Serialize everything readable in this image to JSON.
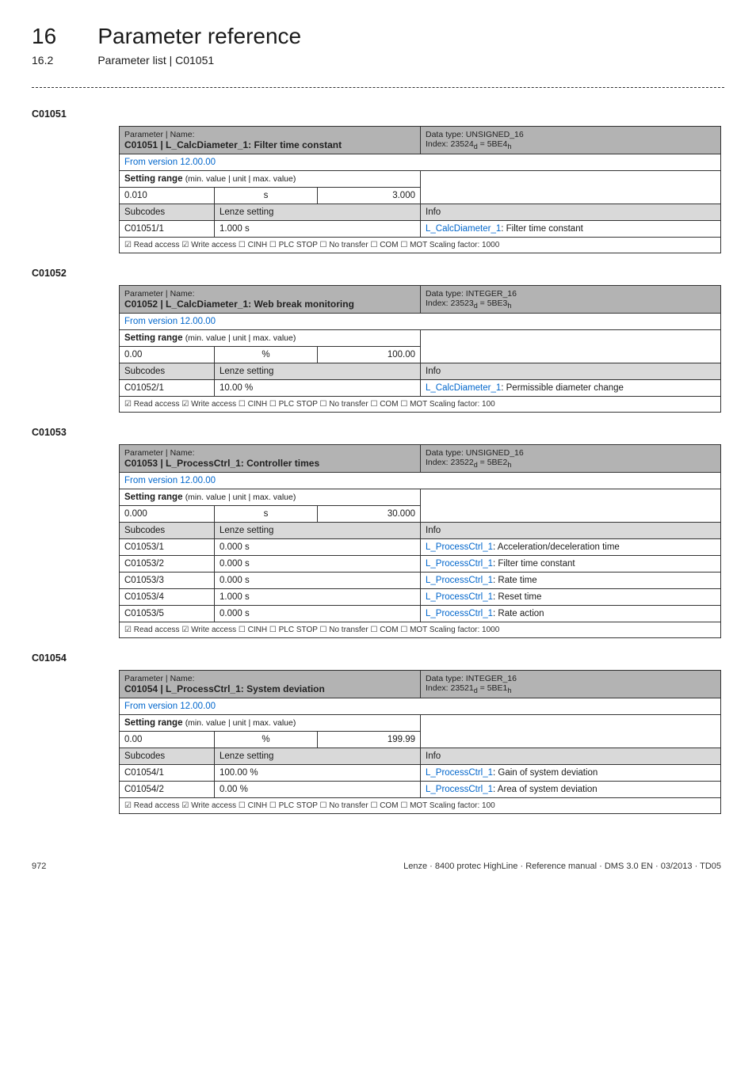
{
  "header": {
    "chapter_num": "16",
    "chapter_title": "Parameter reference",
    "sub_num": "16.2",
    "sub_title": "Parameter list | C01051"
  },
  "tables": {
    "t1": {
      "anchor": "C01051",
      "hdr_label": "Parameter | Name:",
      "name": "C01051 | L_CalcDiameter_1: Filter time constant",
      "dt_line1": "Data type: UNSIGNED_16",
      "dt_line2_prefix": "Index: 23524",
      "dt_line2_sub1": "d",
      "dt_line2_mid": " = 5BE4",
      "dt_line2_sub2": "h",
      "version": "From version 12.00.00",
      "range_label": "Setting range ",
      "range_sub": "(min. value | unit | max. value)",
      "min": "0.010",
      "unit": "s",
      "max": "3.000",
      "sub_hdr1": "Subcodes",
      "sub_hdr2": "Lenze setting",
      "sub_hdr3": "Info",
      "rows": [
        {
          "code": "C01051/1",
          "setting": "1.000 s",
          "info_link": "L_CalcDiameter_1",
          "info_rest": ": Filter time constant"
        }
      ],
      "footer": "☑ Read access   ☑ Write access   ☐ CINH   ☐ PLC STOP   ☐ No transfer   ☐ COM   ☐ MOT     Scaling factor: 1000"
    },
    "t2": {
      "anchor": "C01052",
      "hdr_label": "Parameter | Name:",
      "name": "C01052 | L_CalcDiameter_1: Web break monitoring",
      "dt_line1": "Data type: INTEGER_16",
      "dt_line2_prefix": "Index: 23523",
      "dt_line2_sub1": "d",
      "dt_line2_mid": " = 5BE3",
      "dt_line2_sub2": "h",
      "version": "From version 12.00.00",
      "range_label": "Setting range ",
      "range_sub": "(min. value | unit | max. value)",
      "min": "0.00",
      "unit": "%",
      "max": "100.00",
      "sub_hdr1": "Subcodes",
      "sub_hdr2": "Lenze setting",
      "sub_hdr3": "Info",
      "rows": [
        {
          "code": "C01052/1",
          "setting": "10.00 %",
          "info_link": "L_CalcDiameter_1",
          "info_rest": ": Permissible diameter change"
        }
      ],
      "footer": "☑ Read access   ☑ Write access   ☐ CINH   ☐ PLC STOP   ☐ No transfer   ☐ COM   ☐ MOT     Scaling factor: 100"
    },
    "t3": {
      "anchor": "C01053",
      "hdr_label": "Parameter | Name:",
      "name": "C01053 | L_ProcessCtrl_1: Controller times",
      "dt_line1": "Data type: UNSIGNED_16",
      "dt_line2_prefix": "Index: 23522",
      "dt_line2_sub1": "d",
      "dt_line2_mid": " = 5BE2",
      "dt_line2_sub2": "h",
      "version": "From version 12.00.00",
      "range_label": "Setting range ",
      "range_sub": "(min. value | unit | max. value)",
      "min": "0.000",
      "unit": "s",
      "max": "30.000",
      "sub_hdr1": "Subcodes",
      "sub_hdr2": "Lenze setting",
      "sub_hdr3": "Info",
      "rows": [
        {
          "code": "C01053/1",
          "setting": "0.000 s",
          "info_link": "L_ProcessCtrl_1",
          "info_rest": ": Acceleration/deceleration time"
        },
        {
          "code": "C01053/2",
          "setting": "0.000 s",
          "info_link": "L_ProcessCtrl_1",
          "info_rest": ": Filter time constant"
        },
        {
          "code": "C01053/3",
          "setting": "0.000 s",
          "info_link": "L_ProcessCtrl_1",
          "info_rest": ": Rate time"
        },
        {
          "code": "C01053/4",
          "setting": "1.000 s",
          "info_link": "L_ProcessCtrl_1",
          "info_rest": ": Reset time"
        },
        {
          "code": "C01053/5",
          "setting": "0.000 s",
          "info_link": "L_ProcessCtrl_1",
          "info_rest": ": Rate action"
        }
      ],
      "footer": "☑ Read access   ☑ Write access   ☐ CINH   ☐ PLC STOP   ☐ No transfer   ☐ COM   ☐ MOT     Scaling factor: 1000"
    },
    "t4": {
      "anchor": "C01054",
      "hdr_label": "Parameter | Name:",
      "name": "C01054 | L_ProcessCtrl_1: System deviation",
      "dt_line1": "Data type: INTEGER_16",
      "dt_line2_prefix": "Index: 23521",
      "dt_line2_sub1": "d",
      "dt_line2_mid": " = 5BE1",
      "dt_line2_sub2": "h",
      "version": "From version 12.00.00",
      "range_label": "Setting range ",
      "range_sub": "(min. value | unit | max. value)",
      "min": "0.00",
      "unit": "%",
      "max": "199.99",
      "sub_hdr1": "Subcodes",
      "sub_hdr2": "Lenze setting",
      "sub_hdr3": "Info",
      "rows": [
        {
          "code": "C01054/1",
          "setting": "100.00 %",
          "info_link": "L_ProcessCtrl_1",
          "info_rest": ": Gain of system deviation"
        },
        {
          "code": "C01054/2",
          "setting": "0.00 %",
          "info_link": "L_ProcessCtrl_1",
          "info_rest": ": Area of system deviation"
        }
      ],
      "footer": "☑ Read access   ☑ Write access   ☐ CINH   ☐ PLC STOP   ☐ No transfer   ☐ COM   ☐ MOT     Scaling factor: 100"
    }
  },
  "footer": {
    "page": "972",
    "text": "Lenze · 8400 protec HighLine · Reference manual · DMS 3.0 EN · 03/2013 · TD05"
  }
}
